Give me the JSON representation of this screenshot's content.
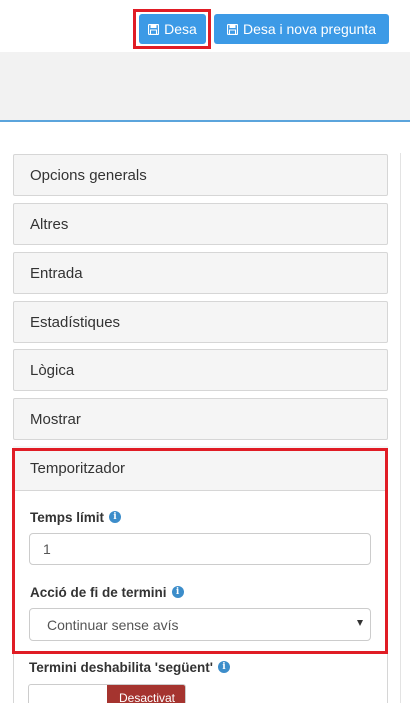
{
  "toolbar": {
    "save_label": "Desa",
    "save_new_label": "Desa i nova pregunta"
  },
  "panels": [
    {
      "label": "Opcions generals"
    },
    {
      "label": "Altres"
    },
    {
      "label": "Entrada"
    },
    {
      "label": "Estadístiques"
    },
    {
      "label": "Lògica"
    },
    {
      "label": "Mostrar"
    }
  ],
  "timer": {
    "heading": "Temporitzador",
    "time_limit_label": "Temps límit",
    "time_limit_value": "1",
    "action_label": "Acció de fi de termini",
    "action_value": "Continuar sense avís",
    "disable_next_label": "Termini deshabilita 'següent'",
    "disable_next_toggle": "Desactivat"
  },
  "icons": {
    "save": "floppy-disk-icon",
    "info": "info-circle-icon",
    "dropdown": "caret-down-icon"
  },
  "colors": {
    "button_blue": "#3c9ae6",
    "highlight_red": "#e01c25",
    "toggle_off_red": "#a5342f",
    "info_blue": "#3c8dca"
  }
}
